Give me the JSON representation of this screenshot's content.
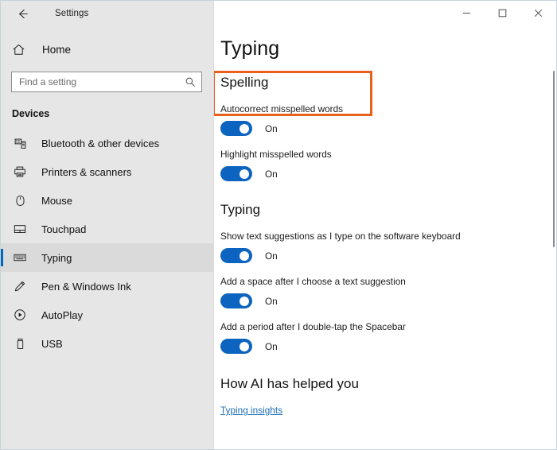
{
  "window": {
    "app_title": "Settings",
    "back_icon": "back-arrow-icon",
    "controls": {
      "minimize": "–",
      "maximize": "☐",
      "close": "✕"
    }
  },
  "sidebar": {
    "home_label": "Home",
    "home_icon": "home-icon",
    "search": {
      "placeholder": "Find a setting",
      "value": "",
      "icon": "search-icon"
    },
    "category": "Devices",
    "items": [
      {
        "label": "Bluetooth & other devices",
        "icon": "bluetooth-devices-icon",
        "selected": false
      },
      {
        "label": "Printers & scanners",
        "icon": "printer-icon",
        "selected": false
      },
      {
        "label": "Mouse",
        "icon": "mouse-icon",
        "selected": false
      },
      {
        "label": "Touchpad",
        "icon": "touchpad-icon",
        "selected": false
      },
      {
        "label": "Typing",
        "icon": "keyboard-icon",
        "selected": true
      },
      {
        "label": "Pen & Windows Ink",
        "icon": "pen-icon",
        "selected": false
      },
      {
        "label": "AutoPlay",
        "icon": "autoplay-icon",
        "selected": false
      },
      {
        "label": "USB",
        "icon": "usb-icon",
        "selected": false
      }
    ]
  },
  "main": {
    "page_title": "Typing",
    "spelling": {
      "heading": "Spelling",
      "settings": [
        {
          "label": "Autocorrect misspelled words",
          "state": "On",
          "highlighted": true
        },
        {
          "label": "Highlight misspelled words",
          "state": "On",
          "highlighted": false
        }
      ]
    },
    "typing": {
      "heading": "Typing",
      "settings": [
        {
          "label": "Show text suggestions as I type on the software keyboard",
          "state": "On"
        },
        {
          "label": "Add a space after I choose a text suggestion",
          "state": "On"
        },
        {
          "label": "Add a period after I double-tap the Spacebar",
          "state": "On"
        }
      ]
    },
    "ai_section": {
      "heading": "How AI has helped you",
      "link": "Typing insights"
    }
  },
  "colors": {
    "accent_blue": "#0c64c0",
    "highlight_orange": "#e8601c",
    "link_blue": "#1d6fb8",
    "sidebar_bg": "#e6e6e6"
  }
}
